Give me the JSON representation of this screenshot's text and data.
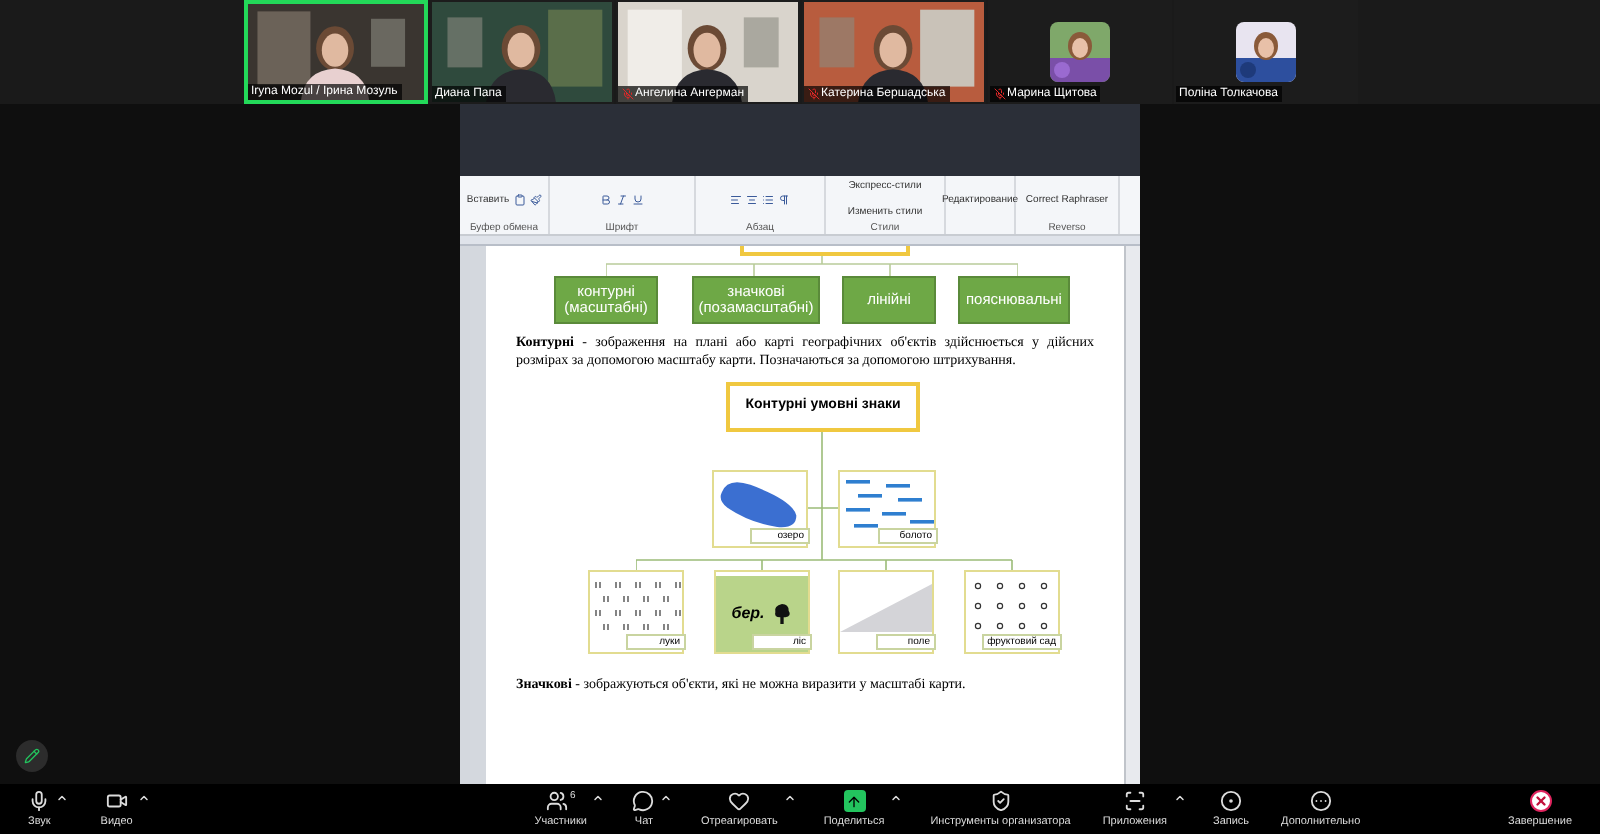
{
  "participants": [
    {
      "name": "Iryna Mozul / Ірина Мозуль",
      "kind": "video",
      "muted": false,
      "speaking": true
    },
    {
      "name": "Диана Папа",
      "kind": "video",
      "muted": false,
      "speaking": false
    },
    {
      "name": "Ангелина Ангерман",
      "kind": "video",
      "muted": true,
      "speaking": false
    },
    {
      "name": "Катерина Бершадська",
      "kind": "video",
      "muted": true,
      "speaking": false
    },
    {
      "name": "Марина Щитова",
      "kind": "avatar",
      "muted": true,
      "speaking": false
    },
    {
      "name": "Поліна Толкачова",
      "kind": "avatar",
      "muted": false,
      "speaking": false
    }
  ],
  "ribbon": {
    "groups": [
      {
        "label": "Буфер обмена",
        "buttons": [
          "Вставить"
        ]
      },
      {
        "label": "Шрифт"
      },
      {
        "label": "Абзац"
      },
      {
        "label": "Стили",
        "buttons": [
          "Экспресс-стили",
          "Изменить стили"
        ]
      },
      {
        "buttons": [
          "Редактирование"
        ]
      },
      {
        "label": "Reverso",
        "buttons": [
          "Correct Raphraser"
        ]
      }
    ]
  },
  "document": {
    "categories": [
      "контурні (масштабні)",
      "значкові (позамасштабні)",
      "лінійні",
      "пояснювальні"
    ],
    "paragraph_1": "**Контурні** - зображення на плані або карті географічних об'єктів здійснюється у дійсних розмірах за допомогою масштабу карти. Позначаються за допомогою штрихування.",
    "diagram_title": "Контурні умовні знаки",
    "signs": [
      {
        "kind": "lake",
        "label": "озеро"
      },
      {
        "kind": "swamp",
        "label": "болото"
      },
      {
        "kind": "meadow",
        "label": "луки"
      },
      {
        "kind": "forest",
        "label": "ліс",
        "text": "бер."
      },
      {
        "kind": "field",
        "label": "поле"
      },
      {
        "kind": "orchard",
        "label": "фруктовий сад"
      }
    ],
    "paragraph_2": "**Значкові** - зображуються об'єкти, які не можна виразити у масштабі карти."
  },
  "toolbar": [
    {
      "kind": "audio",
      "label": "Звук",
      "menu": true
    },
    {
      "kind": "video",
      "label": "Видео",
      "menu": true
    },
    {
      "kind": "participants",
      "label": "Участники",
      "badge": "6",
      "menu": true
    },
    {
      "kind": "chat",
      "label": "Чат",
      "menu": true
    },
    {
      "kind": "react",
      "label": "Отреагировать",
      "menu": true
    },
    {
      "kind": "share",
      "label": "Поделиться",
      "menu": true
    },
    {
      "kind": "host",
      "label": "Инструменты организатора",
      "menu": false
    },
    {
      "kind": "apps",
      "label": "Приложения",
      "menu": true
    },
    {
      "kind": "record",
      "label": "Запись",
      "menu": false
    },
    {
      "kind": "more",
      "label": "Дополнительно",
      "menu": false
    },
    {
      "kind": "end",
      "label": "Завершение",
      "menu": false
    }
  ]
}
